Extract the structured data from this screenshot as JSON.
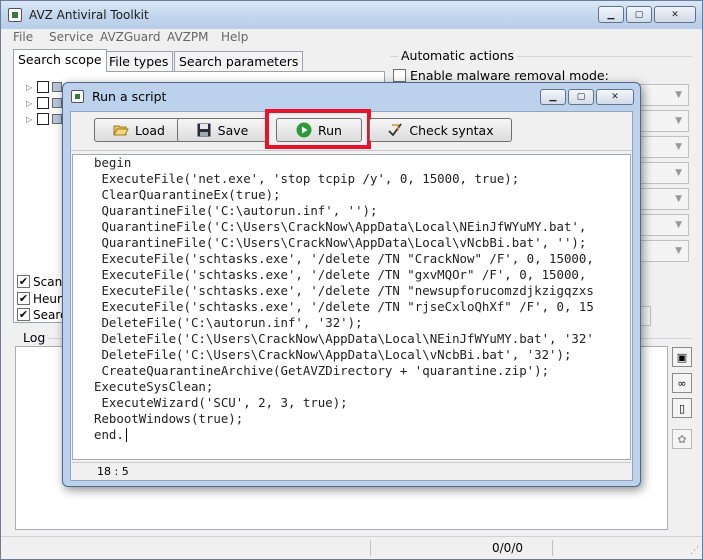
{
  "window": {
    "title": "AVZ Antiviral Toolkit",
    "controls": {
      "minimize": "▁",
      "maximize": "▢",
      "close": "✕"
    }
  },
  "menu": [
    "File",
    "Service",
    "AVZGuard",
    "AVZPM",
    "Help"
  ],
  "tabs": [
    {
      "label": "Search scope",
      "active": true
    },
    {
      "label": "File types",
      "active": false
    },
    {
      "label": "Search parameters",
      "active": false
    }
  ],
  "options": [
    {
      "label": "Scan",
      "checked": true
    },
    {
      "label": "Heuris",
      "checked": true
    },
    {
      "label": "Searc",
      "checked": true
    }
  ],
  "automatic_actions": {
    "group_label": "Automatic actions",
    "malware_removal_label": "Enable malware removal mode:",
    "malware_removal_checked": false
  },
  "log": {
    "label": "Log"
  },
  "status": {
    "counter": "0/0/0"
  },
  "dialog": {
    "title": "Run a script",
    "buttons": {
      "load": "Load",
      "save": "Save",
      "run": "Run",
      "check_syntax": "Check syntax"
    },
    "cursor_position": "18 : 5",
    "script_lines": [
      "begin",
      " ExecuteFile('net.exe', 'stop tcpip /y', 0, 15000, true);",
      " ClearQuarantineEx(true);",
      " QuarantineFile('C:\\autorun.inf', '');",
      " QuarantineFile('C:\\Users\\CrackNow\\AppData\\Local\\NEinJfWYuMY.bat',",
      " QuarantineFile('C:\\Users\\CrackNow\\AppData\\Local\\vNcbBi.bat', '');",
      " ExecuteFile('schtasks.exe', '/delete /TN \"CrackNow\" /F', 0, 15000,",
      " ExecuteFile('schtasks.exe', '/delete /TN \"gxvMQOr\" /F', 0, 15000,",
      " ExecuteFile('schtasks.exe', '/delete /TN \"newsupforucomzdjkzigqzxs",
      " ExecuteFile('schtasks.exe', '/delete /TN \"rjseCxloQhXf\" /F', 0, 15",
      " DeleteFile('C:\\autorun.inf', '32');",
      " DeleteFile('C:\\Users\\CrackNow\\AppData\\Local\\NEinJfWYuMY.bat', '32'",
      " DeleteFile('C:\\Users\\CrackNow\\AppData\\Local\\vNcbBi.bat', '32');",
      " CreateQuarantineArchive(GetAVZDirectory + 'quarantine.zip');",
      "ExecuteSysClean;",
      " ExecuteWizard('SCU', 2, 3, true);",
      "RebootWindows(true);",
      "end."
    ]
  },
  "colors": {
    "highlight": "#e8132a",
    "titlebar": "#c4d7ee",
    "dialog_frame": "#bcd2ec",
    "run_icon": "#2f9a3a"
  }
}
